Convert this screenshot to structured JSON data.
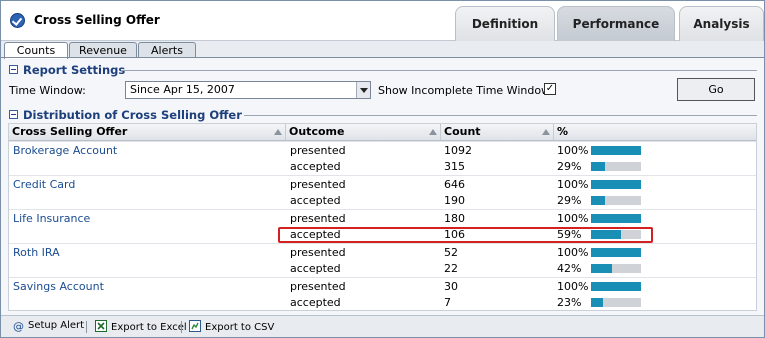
{
  "app": {
    "title": "Cross Selling Offer"
  },
  "top_tabs": [
    {
      "label": "Definition",
      "active": false
    },
    {
      "label": "Performance",
      "active": true
    },
    {
      "label": "Analysis",
      "active": false
    }
  ],
  "sub_tabs": [
    {
      "label": "Counts",
      "active": true
    },
    {
      "label": "Revenue",
      "active": false
    },
    {
      "label": "Alerts",
      "active": false
    }
  ],
  "report_settings": {
    "heading": "Report Settings",
    "time_window_label": "Time Window:",
    "time_window_value": "Since Apr 15, 2007",
    "incomplete_label": "Show Incomplete Time Window:",
    "incomplete_checked": true,
    "go_label": "Go"
  },
  "distribution": {
    "heading": "Distribution of Cross Selling Offer",
    "columns": [
      "Cross Selling Offer",
      "Outcome",
      "Count",
      "%"
    ],
    "rows": [
      {
        "offer": "Brokerage Account",
        "outcome": "presented",
        "count": "1092",
        "pct": "100%",
        "fraction": 1.0
      },
      {
        "offer": "",
        "outcome": "accepted",
        "count": "315",
        "pct": "29%",
        "fraction": 0.29
      },
      {
        "offer": "Credit Card",
        "outcome": "presented",
        "count": "646",
        "pct": "100%",
        "fraction": 1.0
      },
      {
        "offer": "",
        "outcome": "accepted",
        "count": "190",
        "pct": "29%",
        "fraction": 0.29
      },
      {
        "offer": "Life Insurance",
        "outcome": "presented",
        "count": "180",
        "pct": "100%",
        "fraction": 1.0
      },
      {
        "offer": "",
        "outcome": "accepted",
        "count": "106",
        "pct": "59%",
        "fraction": 0.59
      },
      {
        "offer": "Roth IRA",
        "outcome": "presented",
        "count": "52",
        "pct": "100%",
        "fraction": 1.0
      },
      {
        "offer": "",
        "outcome": "accepted",
        "count": "22",
        "pct": "42%",
        "fraction": 0.42
      },
      {
        "offer": "Savings Account",
        "outcome": "presented",
        "count": "30",
        "pct": "100%",
        "fraction": 1.0
      },
      {
        "offer": "",
        "outcome": "accepted",
        "count": "7",
        "pct": "23%",
        "fraction": 0.23
      }
    ]
  },
  "footer": {
    "setup_alert": "Setup Alert",
    "export_excel": "Export to Excel",
    "export_csv": "Export to CSV"
  },
  "colors": {
    "bar_fill": "#1a8fb6",
    "bar_track": "#cfd3d8",
    "highlight": "#d32020",
    "link": "#1b4c91"
  }
}
